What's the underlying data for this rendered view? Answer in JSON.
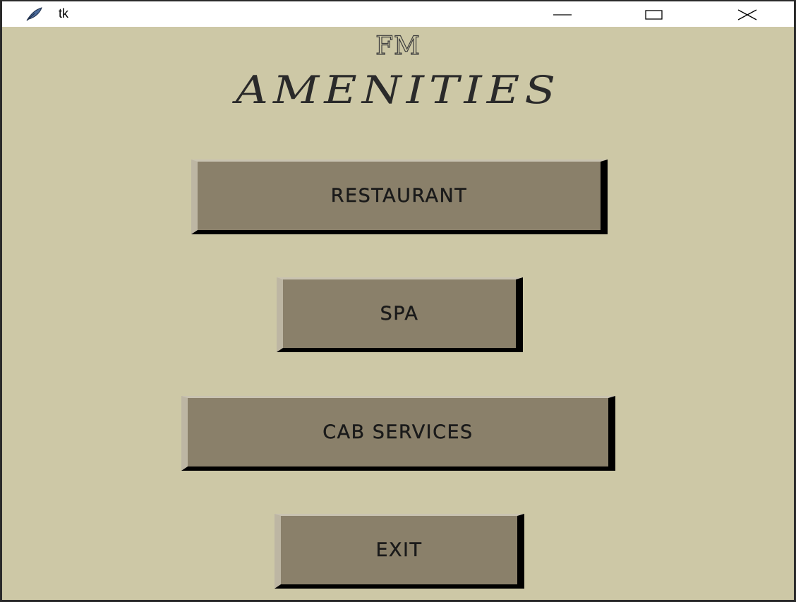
{
  "window": {
    "title": "tk",
    "icon": "tk-feather-icon",
    "controls": {
      "minimize_icon": "minimize-icon",
      "maximize_icon": "maximize-icon",
      "close_icon": "close-icon"
    }
  },
  "header": {
    "brand": "FM",
    "title": "AMENITIES"
  },
  "menu": {
    "restaurant_label": "RESTAURANT",
    "spa_label": "SPA",
    "cab_label": "CAB SERVICES",
    "exit_label": "EXIT"
  },
  "colors": {
    "background": "#cdc8a6",
    "button_face": "#8a806a",
    "button_shadow": "#000000",
    "button_highlight": "#bdb6a3"
  }
}
